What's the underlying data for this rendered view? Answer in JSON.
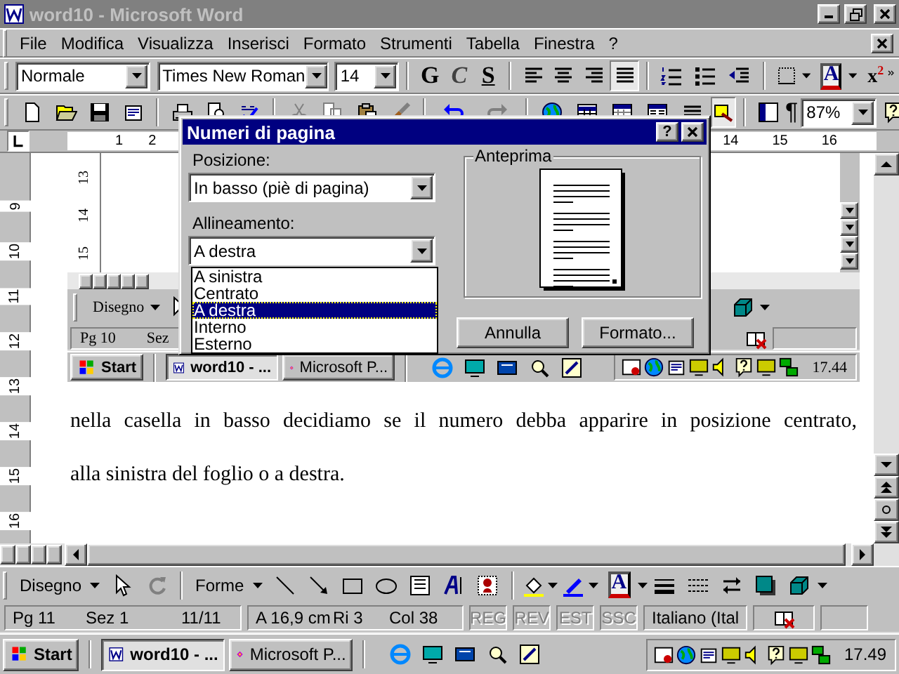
{
  "window": {
    "title": "word10 - Microsoft Word",
    "active": false
  },
  "menu": [
    "File",
    "Modifica",
    "Visualizza",
    "Inserisci",
    "Formato",
    "Strumenti",
    "Tabella",
    "Finestra",
    "?"
  ],
  "format_toolbar": {
    "style": "Normale",
    "font": "Times New Roman",
    "size": "14",
    "emphasis": [
      {
        "label": "G",
        "kind": "bold"
      },
      {
        "label": "C",
        "kind": "italic"
      },
      {
        "label": "S",
        "kind": "underline"
      }
    ],
    "align": [
      {
        "kind": "left",
        "on": false
      },
      {
        "kind": "center",
        "on": false
      },
      {
        "kind": "right",
        "on": false
      },
      {
        "kind": "justify",
        "on": true
      }
    ],
    "font_color": "A",
    "superscript": "x$^{2}$"
  },
  "standard_toolbar": {
    "drawing_on": true,
    "pilcrow": "¶",
    "zoom": "87%"
  },
  "ruler": {
    "left_labels": [
      "1",
      "2"
    ],
    "right_labels": [
      "14",
      "15",
      "16"
    ]
  },
  "vertical_ruler": [
    "9",
    "10",
    "11",
    "12",
    "13",
    "14",
    "15",
    "16"
  ],
  "document": {
    "screenshot": {
      "ruler_labels": [
        "13",
        "14",
        "15"
      ],
      "draw_menu": "Disegno",
      "status": [
        "Pg 10",
        "Sez"
      ],
      "taskbar": {
        "start": "Start",
        "tasks": [
          {
            "label": "word10 - ...",
            "selected": true
          },
          {
            "label": "Microsoft P...",
            "selected": false
          }
        ],
        "clock": "17.44"
      }
    },
    "lines": [
      "nella casella in basso decidiamo se il numero debba apparire in posizione centrato,",
      "alla sinistra del foglio o a destra."
    ]
  },
  "drawing_toolbar": {
    "draw_menu": "Disegno",
    "shapes_menu": "Forme",
    "font_color": "A"
  },
  "status_bar": {
    "groups": [
      [
        "Pg 11",
        "Sez 1",
        "11/11"
      ],
      [
        "A 16,9 cm",
        "Ri 3",
        "Col 38"
      ]
    ],
    "indicators": [
      {
        "label": "REG",
        "disabled": true
      },
      {
        "label": "REV",
        "disabled": true
      },
      {
        "label": "EST",
        "disabled": true
      },
      {
        "label": "SSC",
        "disabled": true
      }
    ],
    "language": "Italiano (Ital"
  },
  "taskbar": {
    "start": "Start",
    "tasks": [
      {
        "label": "word10 - ...",
        "selected": true
      },
      {
        "label": "Microsoft P...",
        "selected": false
      }
    ],
    "clock": "17.49"
  },
  "dialog": {
    "title": "Numeri di pagina",
    "help": "?",
    "position_label": "Posizione:",
    "position_value": "In basso (piè di pagina)",
    "alignment_label": "Allineamento:",
    "alignment_value": "A destra",
    "alignment_options": [
      {
        "label": "A sinistra",
        "selected": false
      },
      {
        "label": "Centrato",
        "selected": false
      },
      {
        "label": "A destra",
        "selected": true
      },
      {
        "label": "Interno",
        "selected": false
      },
      {
        "label": "Esterno",
        "selected": false
      }
    ],
    "preview_label": "Anteprima",
    "buttons": [
      "Annulla",
      "Formato..."
    ]
  }
}
